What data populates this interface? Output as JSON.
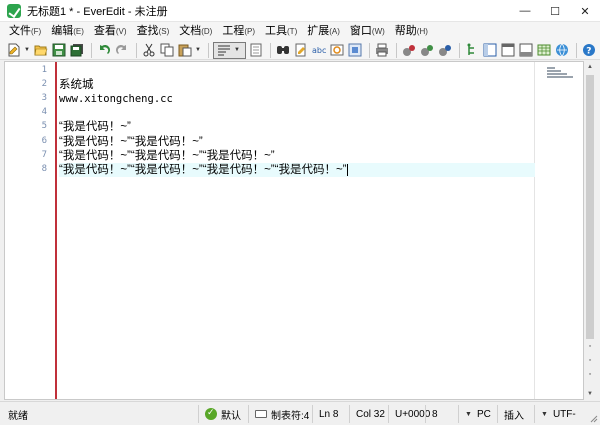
{
  "window": {
    "title": "无标题1 * - EverEdit - 未注册",
    "controls": {
      "minimize": "—",
      "maximize": "☐",
      "close": "✕"
    }
  },
  "menu": [
    {
      "label": "文件",
      "key": "(F)"
    },
    {
      "label": "编辑",
      "key": "(E)"
    },
    {
      "label": "查看",
      "key": "(V)"
    },
    {
      "label": "查找",
      "key": "(S)"
    },
    {
      "label": "文档",
      "key": "(D)"
    },
    {
      "label": "工程",
      "key": "(P)"
    },
    {
      "label": "工具",
      "key": "(T)"
    },
    {
      "label": "扩展",
      "key": "(A)"
    },
    {
      "label": "窗口",
      "key": "(W)"
    },
    {
      "label": "帮助",
      "key": "(H)"
    }
  ],
  "toolbar_icons": [
    "new-file-icon",
    "open-folder-icon",
    "save-icon",
    "save-all-icon",
    "undo-icon",
    "redo-icon",
    "cut-icon",
    "copy-icon",
    "paste-icon",
    "word-wrap-icon",
    "page-view-icon",
    "find-icon",
    "replace-icon",
    "find-in-files-icon",
    "bookmark-icon",
    "find-next-icon",
    "print-icon",
    "macro-record-icon",
    "macro-play-icon",
    "macro-step-icon",
    "tree-icon",
    "split-view-icon",
    "window-icon",
    "panel-icon",
    "table-icon",
    "browser-icon",
    "help-icon"
  ],
  "editor": {
    "lines": [
      {
        "no": "1",
        "text": ""
      },
      {
        "no": "2",
        "text": "系统城"
      },
      {
        "no": "3",
        "text": "www.xitongcheng.cc"
      },
      {
        "no": "4",
        "text": ""
      },
      {
        "no": "5",
        "text": "“我是代码！~”"
      },
      {
        "no": "6",
        "text": "“我是代码！~”“我是代码！~”"
      },
      {
        "no": "7",
        "text": "“我是代码！~”“我是代码！~”“我是代码！~”"
      },
      {
        "no": "8",
        "text": "“我是代码！~”“我是代码！~”“我是代码！~”“我是代码！~”"
      }
    ],
    "current_line": 8
  },
  "status": {
    "ready": "就绪",
    "mode": "默认",
    "tab": "制表符:4",
    "line": "Ln 8",
    "col": "Col 32",
    "char": "U+0000",
    "tab_width": "8",
    "eol": "PC",
    "insert": "插入",
    "encoding": "UTF-"
  },
  "colors": {
    "margin_line": "#c0303a",
    "current_line_bg": "#e8fbfd",
    "line_number": "#7a8fb0",
    "app_icon": "#2da44e"
  }
}
